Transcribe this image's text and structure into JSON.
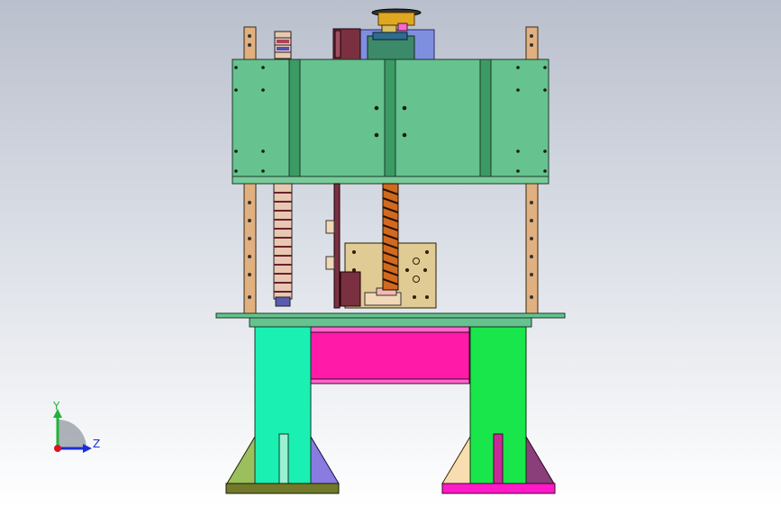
{
  "viewport": {
    "background_top": "#b9bfcc",
    "background_bottom": "#ffffff"
  },
  "triad": {
    "y_label": "Y",
    "z_label": "Z",
    "y_color": "#1fb33a",
    "z_color": "#1b2fd6",
    "origin_color": "#e01020"
  },
  "colors": {
    "upper_housing": "#66c28f",
    "housing_rib": "#3c9a64",
    "column": "#e0b080",
    "screw": "#d06a20",
    "mount_plate": "#e0cb95",
    "table_top": "#66c28f",
    "pink_panel": "#ff1aa8",
    "leg_left": "#1af0b2",
    "leg_right": "#19e64a",
    "base_left": "#707a2a",
    "base_right": "#ff19c8",
    "gusset_olive": "#9bbf5c",
    "gusset_purple": "#8a7be0",
    "gusset_cream": "#f7ddb0",
    "gusset_plum": "#8a3e7a"
  }
}
